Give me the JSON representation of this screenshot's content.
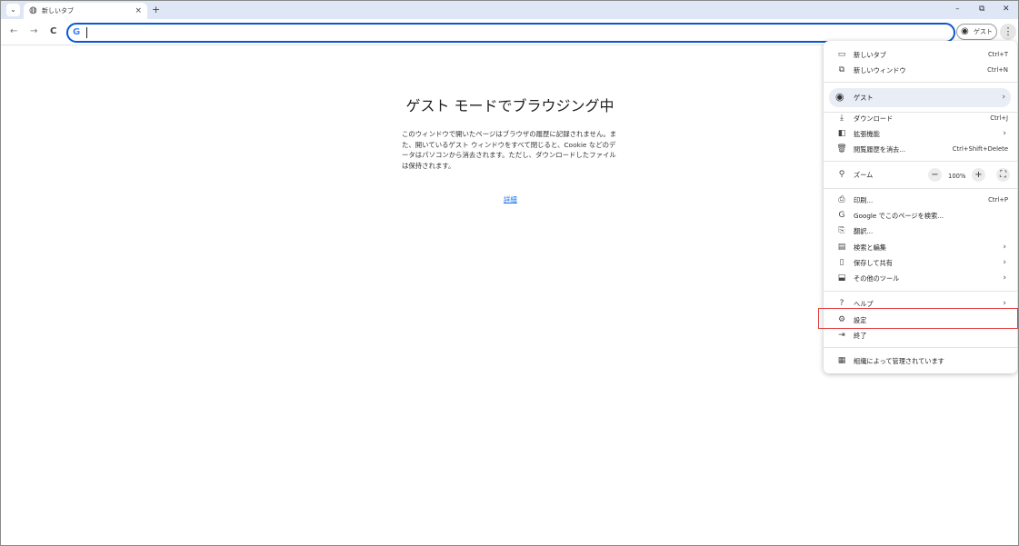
{
  "tab": {
    "title": "新しいタブ",
    "close": "×"
  },
  "tabstrip": {
    "newtab": "+",
    "tabsearch": "⌄",
    "minimize": "–",
    "restore": "⧉",
    "close": "✕"
  },
  "toolbar": {
    "back": "←",
    "forward": "→",
    "reload": "C",
    "omnibox_value": "",
    "guest_label": "ゲスト",
    "menu_glyph": "⋮"
  },
  "page": {
    "heading": "ゲスト モードでブラウジング中",
    "description": "このウィンドウで開いたページはブラウザの履歴に記録されません。また、開いているゲスト ウィンドウをすべて閉じると、Cookie などのデータはパソコンから消去されます。ただし、ダウンロードしたファイルは保持されます。",
    "learn_more": "詳細"
  },
  "menu": {
    "new_tab": {
      "label": "新しいタブ",
      "shortcut": "Ctrl+T"
    },
    "new_window": {
      "label": "新しいウィンドウ",
      "shortcut": "Ctrl+N"
    },
    "profile": {
      "label": "ゲスト"
    },
    "downloads": {
      "label": "ダウンロード",
      "shortcut": "Ctrl+J"
    },
    "extensions": {
      "label": "拡張機能"
    },
    "clear_history": {
      "label": "閲覧履歴を消去...",
      "shortcut": "Ctrl+Shift+Delete"
    },
    "zoom": {
      "label": "ズーム",
      "value": "100%",
      "minus": "−",
      "plus": "+"
    },
    "print": {
      "label": "印刷...",
      "shortcut": "Ctrl+P"
    },
    "search_page": {
      "label": "Google でこのページを検索..."
    },
    "translate": {
      "label": "翻訳..."
    },
    "find_edit": {
      "label": "検索と編集"
    },
    "save_share": {
      "label": "保存して共有"
    },
    "more_tools": {
      "label": "その他のツール"
    },
    "help": {
      "label": "ヘルプ"
    },
    "settings": {
      "label": "設定"
    },
    "exit": {
      "label": "終了"
    },
    "managed": {
      "label": "組織によって管理されています"
    },
    "arrow": "›"
  },
  "colors": {
    "accent": "#0b57d0",
    "highlight": "#e03a3a",
    "tabstrip": "#dfe7f7",
    "link": "#1a73e8"
  }
}
